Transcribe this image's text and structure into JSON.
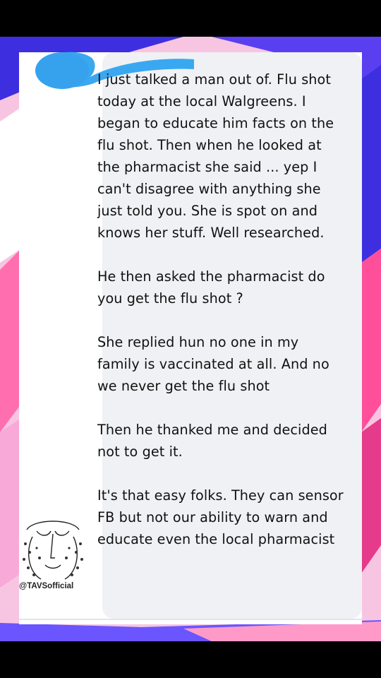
{
  "post": {
    "paragraphs": [
      "I just talked a man out of. Flu shot today at the local Walgreens. I began to educate him facts on the flu shot. Then when he looked at the pharmacist she said ... yep I can't disagree with anything she just told you. She is spot on and knows her stuff. Well researched.",
      "He then asked the pharmacist do you get the flu shot ?",
      "She replied hun no one in my family is vaccinated at all. And no we never get the flu shot",
      "Then he thanked me and decided not to get it.",
      "It's that easy folks. They can sensor FB but not our ability to warn and educate even the local pharmacist"
    ]
  },
  "watermark": {
    "handle": "@TAVSofficial",
    "icon": "tavs-logo-icon"
  },
  "redaction": {
    "icon": "blue-redaction-scribble"
  },
  "colors": {
    "background_blue": "#3d2fe0",
    "background_pink": "#ff4f9a",
    "bubble": "#f0f1f5",
    "redaction": "#3aa8f0",
    "text": "#111111"
  }
}
